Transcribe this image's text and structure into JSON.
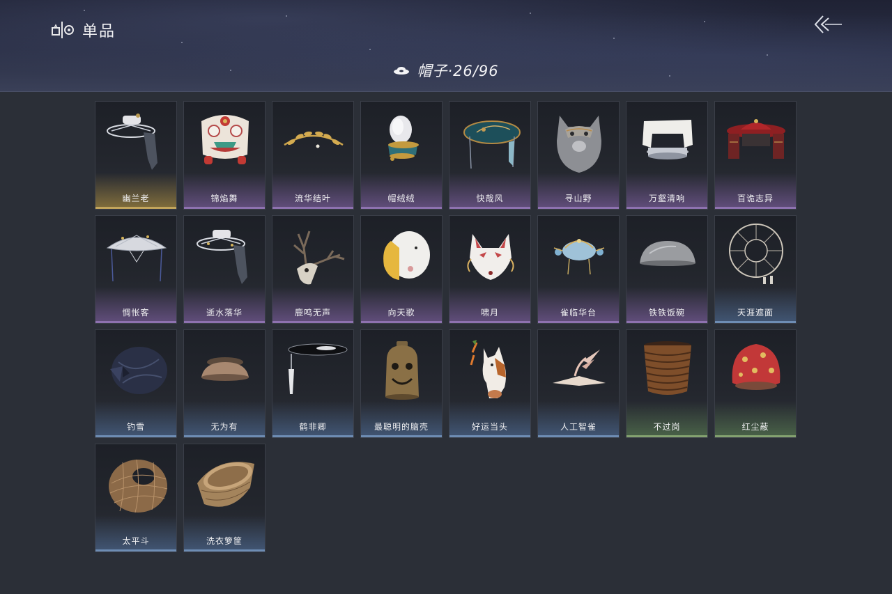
{
  "header": {
    "title": "单品",
    "brand_icon": "wardrobe-logo-icon",
    "back_icon": "double-chevron-left-icon"
  },
  "category": {
    "icon": "hat-icon",
    "title": "帽子·26/96"
  },
  "rarity_colors": {
    "gold": "#c2a55c",
    "purple": "#8e72b0",
    "blue": "#6e8db4",
    "green": "#84a270"
  },
  "items": [
    {
      "name": "幽兰老",
      "rarity": "gold",
      "icon": "veiled-hat-icon"
    },
    {
      "name": "锦焰舞",
      "rarity": "purple",
      "icon": "lion-dance-head-icon"
    },
    {
      "name": "流华结叶",
      "rarity": "purple",
      "icon": "laurel-circlet-icon"
    },
    {
      "name": "帽绒绒",
      "rarity": "purple",
      "icon": "plumed-cap-icon"
    },
    {
      "name": "快哉风",
      "rarity": "purple",
      "icon": "blue-brim-hat-icon"
    },
    {
      "name": "寻山野",
      "rarity": "purple",
      "icon": "wolf-hood-icon"
    },
    {
      "name": "万壑清响",
      "rarity": "purple",
      "icon": "white-cloth-cap-icon"
    },
    {
      "name": "百诡志异",
      "rarity": "purple",
      "icon": "red-curtain-hat-icon"
    },
    {
      "name": "惆怅客",
      "rarity": "purple",
      "icon": "straw-rain-hat-icon"
    },
    {
      "name": "逝水落华",
      "rarity": "purple",
      "icon": "veiled-hat-icon"
    },
    {
      "name": "鹿鸣无声",
      "rarity": "purple",
      "icon": "deer-skull-icon"
    },
    {
      "name": "向天歌",
      "rarity": "purple",
      "icon": "goose-hood-icon"
    },
    {
      "name": "啸月",
      "rarity": "purple",
      "icon": "fox-mask-icon"
    },
    {
      "name": "雀临华台",
      "rarity": "purple",
      "icon": "jeweled-crown-icon"
    },
    {
      "name": "铁铁饭碗",
      "rarity": "purple",
      "icon": "iron-bowl-icon"
    },
    {
      "name": "天涯遮面",
      "rarity": "blue",
      "icon": "wire-frame-hat-icon"
    },
    {
      "name": "钓雪",
      "rarity": "blue",
      "icon": "dark-bamboo-hat-icon"
    },
    {
      "name": "无为有",
      "rarity": "blue",
      "icon": "clay-bowl-icon"
    },
    {
      "name": "鹤非卿",
      "rarity": "blue",
      "icon": "black-brim-hat-icon"
    },
    {
      "name": "最聪明的脑壳",
      "rarity": "blue",
      "icon": "bell-helmet-icon"
    },
    {
      "name": "好运当头",
      "rarity": "blue",
      "icon": "horse-head-icon"
    },
    {
      "name": "人工智雀",
      "rarity": "blue",
      "icon": "paper-bird-icon"
    },
    {
      "name": "不过岗",
      "rarity": "green",
      "icon": "stacked-bowls-icon"
    },
    {
      "name": "红尘蔽",
      "rarity": "green",
      "icon": "red-cloth-hood-icon"
    },
    {
      "name": "太平斗",
      "rarity": "blue",
      "icon": "woven-basket-hat-icon"
    },
    {
      "name": "洗衣箩筐",
      "rarity": "blue",
      "icon": "laundry-basket-icon"
    }
  ]
}
